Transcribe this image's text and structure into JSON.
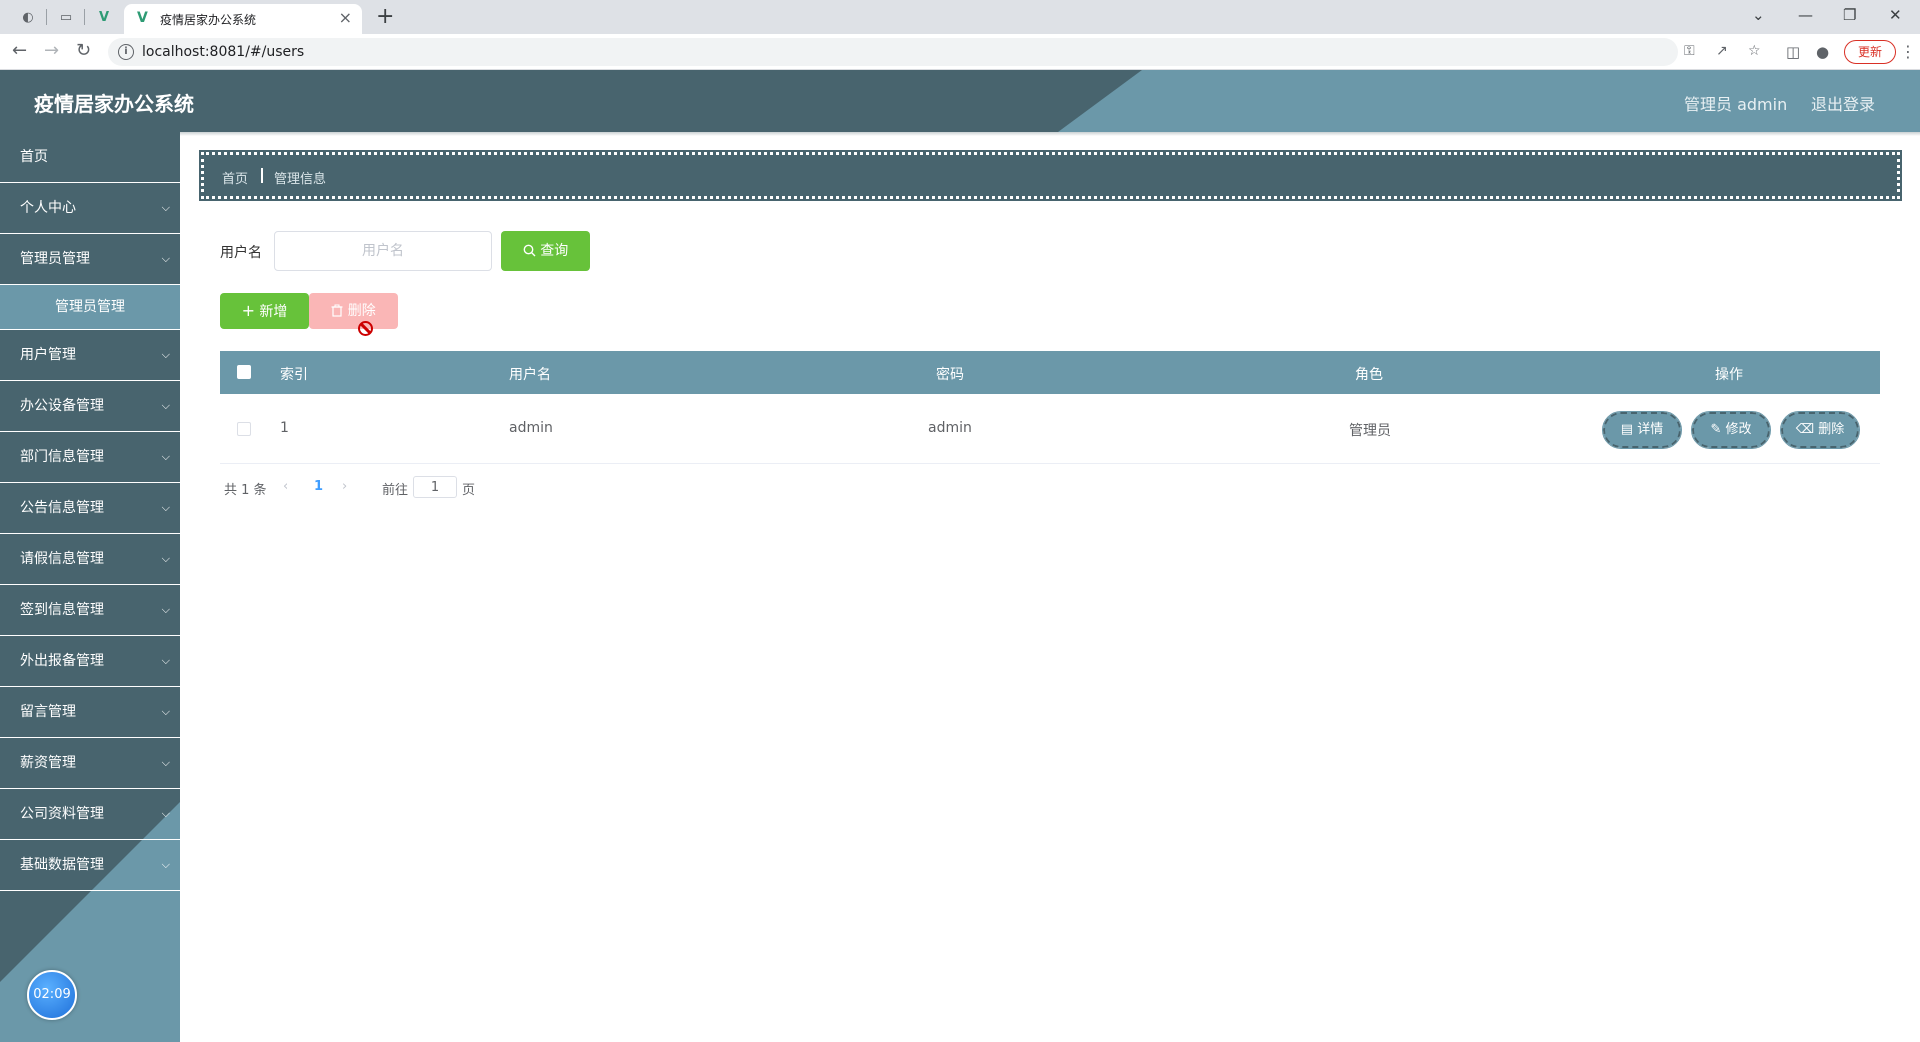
{
  "browser": {
    "tab_title": "疫情居家办公系统",
    "url": "localhost:8081/#/users",
    "update_label": "更新"
  },
  "app": {
    "title": "疫情居家办公系统",
    "user_text": "管理员 admin",
    "logout_label": "退出登录",
    "clock": "02:09"
  },
  "sidebar": {
    "items": [
      {
        "label": "首页",
        "has_chevron": false
      },
      {
        "label": "个人中心",
        "has_chevron": true
      },
      {
        "label": "管理员管理",
        "has_chevron": true
      },
      {
        "label": "管理员管理",
        "has_chevron": false,
        "submenu": true
      },
      {
        "label": "用户管理",
        "has_chevron": true
      },
      {
        "label": "办公设备管理",
        "has_chevron": true
      },
      {
        "label": "部门信息管理",
        "has_chevron": true
      },
      {
        "label": "公告信息管理",
        "has_chevron": true
      },
      {
        "label": "请假信息管理",
        "has_chevron": true
      },
      {
        "label": "签到信息管理",
        "has_chevron": true
      },
      {
        "label": "外出报备管理",
        "has_chevron": true
      },
      {
        "label": "留言管理",
        "has_chevron": true
      },
      {
        "label": "薪资管理",
        "has_chevron": true
      },
      {
        "label": "公司资料管理",
        "has_chevron": true
      },
      {
        "label": "基础数据管理",
        "has_chevron": true
      }
    ]
  },
  "breadcrumb": {
    "home": "首页",
    "current": "管理信息"
  },
  "search": {
    "label": "用户名",
    "placeholder": "用户名",
    "button": "查询"
  },
  "actions": {
    "add": "新增",
    "delete": "删除"
  },
  "table": {
    "headers": {
      "index": "索引",
      "username": "用户名",
      "password": "密码",
      "role": "角色",
      "ops": "操作"
    },
    "rows": [
      {
        "index": "1",
        "username": "admin",
        "password": "admin",
        "role": "管理员"
      }
    ],
    "row_actions": {
      "detail": "详情",
      "edit": "修改",
      "delete": "删除"
    }
  },
  "pagination": {
    "total_text": "共 1 条",
    "current_page": "1",
    "goto_label": "前往",
    "goto_value": "1",
    "page_suffix": "页"
  },
  "colors": {
    "header_dark": "#48646e",
    "accent_light": "#6b98a9",
    "success": "#67c23a",
    "danger_disabled": "#fab6b6"
  }
}
